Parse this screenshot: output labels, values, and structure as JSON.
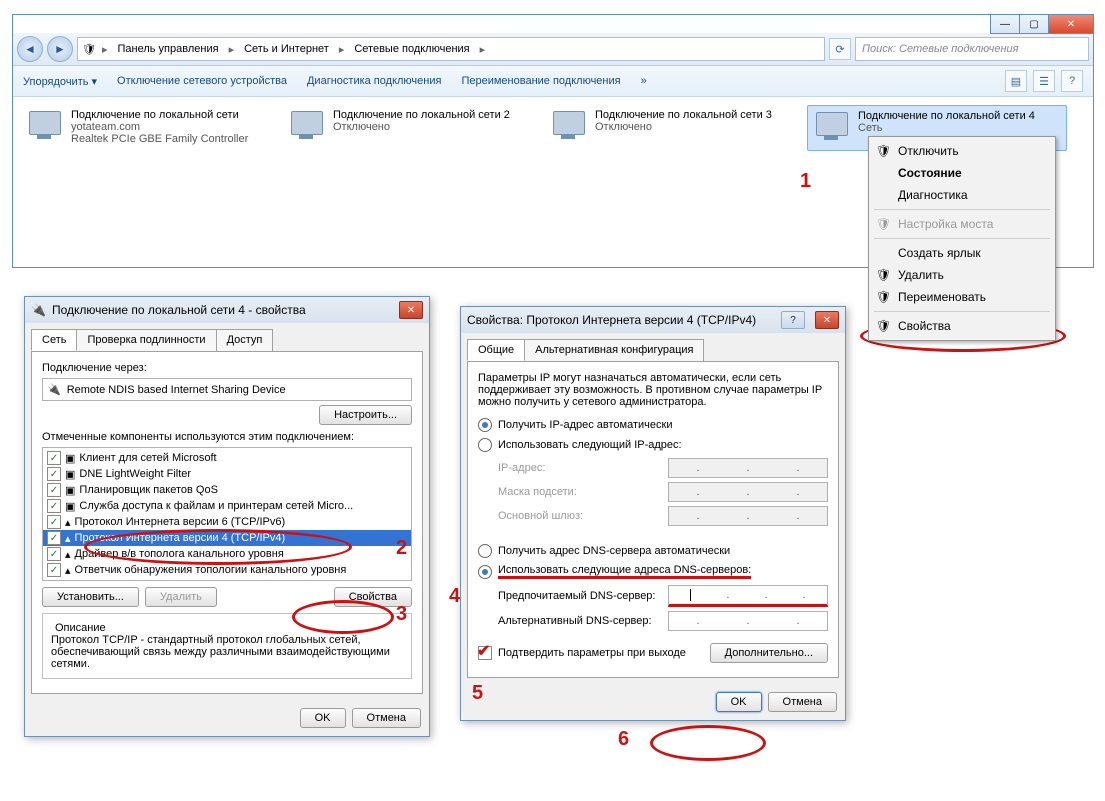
{
  "explorer": {
    "breadcrumb_root": "Панель управления",
    "breadcrumb_1": "Сеть и Интернет",
    "breadcrumb_2": "Сетевые подключения",
    "search_placeholder": "Поиск: Сетевые подключения",
    "toolbar": {
      "organize": "Упорядочить ▾",
      "disable": "Отключение сетевого устройства",
      "diagnose": "Диагностика подключения",
      "rename": "Переименование подключения",
      "more": "»"
    },
    "conns": [
      {
        "name": "Подключение по локальной сети",
        "line2": "yotateam.com",
        "line3": "Realtek PCIe GBE Family Controller"
      },
      {
        "name": "Подключение по локальной сети 2",
        "line2": "Отключено",
        "line3": ""
      },
      {
        "name": "Подключение по локальной сети 3",
        "line2": "Отключено",
        "line3": ""
      },
      {
        "name": "Подключение по локальной сети 4",
        "line2": "Сеть",
        "line3": ""
      }
    ]
  },
  "ctx": {
    "disable": "Отключить",
    "status": "Состояние",
    "diag": "Диагностика",
    "bridge": "Настройка моста",
    "shortcut": "Создать ярлык",
    "delete": "Удалить",
    "rename": "Переименовать",
    "props": "Свойства"
  },
  "dlg1": {
    "title": "Подключение по локальной сети 4 - свойства",
    "tabs": {
      "net": "Сеть",
      "auth": "Проверка подлинности",
      "access": "Доступ"
    },
    "connect_via": "Подключение через:",
    "adapter": "Remote NDIS based Internet Sharing Device",
    "configure": "Настроить...",
    "components": "Отмеченные компоненты используются этим подключением:",
    "items": [
      "Клиент для сетей Microsoft",
      "DNE LightWeight Filter",
      "Планировщик пакетов QoS",
      "Служба доступа к файлам и принтерам сетей Micro...",
      "Протокол Интернета версии 6 (TCP/IPv6)",
      "Протокол Интернета версии 4 (TCP/IPv4)",
      "Драйвер в/в тополога канального уровня",
      "Ответчик обнаружения топологии канального уровня"
    ],
    "install": "Установить...",
    "uninstall": "Удалить",
    "props": "Свойства",
    "descLabel": "Описание",
    "desc": "Протокол TCP/IP - стандартный протокол глобальных сетей, обеспечивающий связь между различными взаимодействующими сетями.",
    "ok": "OK",
    "cancel": "Отмена"
  },
  "dlg2": {
    "title": "Свойства: Протокол Интернета версии 4 (TCP/IPv4)",
    "tabs": {
      "general": "Общие",
      "alt": "Альтернативная конфигурация"
    },
    "intro": "Параметры IP могут назначаться автоматически, если сеть поддерживает эту возможность. В противном случае параметры IP можно получить у сетевого администратора.",
    "r_auto_ip": "Получить IP-адрес автоматически",
    "r_man_ip": "Использовать следующий IP-адрес:",
    "ip": "IP-адрес:",
    "mask": "Маска подсети:",
    "gw": "Основной шлюз:",
    "r_auto_dns": "Получить адрес DNS-сервера автоматически",
    "r_man_dns": "Использовать следующие адреса DNS-серверов:",
    "dns1": "Предпочитаемый DNS-сервер:",
    "dns2": "Альтернативный DNS-сервер:",
    "confirm": "Подтвердить параметры при выходе",
    "advanced": "Дополнительно...",
    "ok": "OK",
    "cancel": "Отмена"
  },
  "annotations": {
    "1": "1",
    "2": "2",
    "3": "3",
    "4": "4",
    "5": "5",
    "6": "6"
  }
}
